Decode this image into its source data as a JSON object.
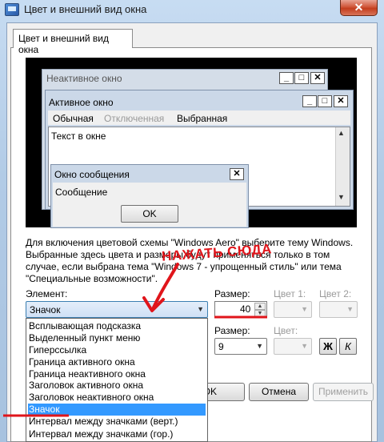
{
  "window": {
    "title": "Цвет и внешний вид окна",
    "close_label": "✕"
  },
  "tab": {
    "label": "Цвет и внешний вид окна"
  },
  "preview": {
    "inactive_title": "Неактивное окно",
    "active_title": "Активное окно",
    "menu": [
      "Обычная",
      "Отключенная",
      "Выбранная"
    ],
    "window_text": "Текст в окне",
    "message_title": "Окно сообщения",
    "message_text": "Сообщение",
    "ok_label": "OK",
    "minimize": "_",
    "maximize": "□",
    "close": "✕"
  },
  "description": "Для включения цветовой схемы \"Windows Aero\" выберите тему Windows. Выбранные здесь цвета и размеры будут применяться только в том случае, если выбрана тема \"Windows 7 - упрощенный стиль\" или тема \"Специальные возможности\".",
  "annotation": {
    "text": "НАЖАТЬ СЮДА",
    "color": "#e0151b"
  },
  "element": {
    "label": "Элемент:",
    "selected": "Значок",
    "items": [
      "Всплывающая подсказка",
      "Выделенный пункт меню",
      "Гиперссылка",
      "Граница активного окна",
      "Граница неактивного окна",
      "Заголовок активного окна",
      "Заголовок неактивного окна",
      "Значок",
      "Интервал между значками (верт.)",
      "Интервал между значками (гор.)"
    ],
    "selected_index": 7
  },
  "size": {
    "label": "Размер:",
    "value": "40"
  },
  "color1": {
    "label": "Цвет 1:"
  },
  "color2": {
    "label": "Цвет 2:"
  },
  "font_size": {
    "label": "Размер:",
    "value": "9"
  },
  "font_color": {
    "label": "Цвет:"
  },
  "style_buttons": {
    "bold": "Ж",
    "italic": "К"
  },
  "buttons": {
    "ok": "OK",
    "cancel": "Отмена",
    "apply": "Применить"
  },
  "colors": {
    "selection": "#3399ff",
    "accent": "#e0151b"
  }
}
